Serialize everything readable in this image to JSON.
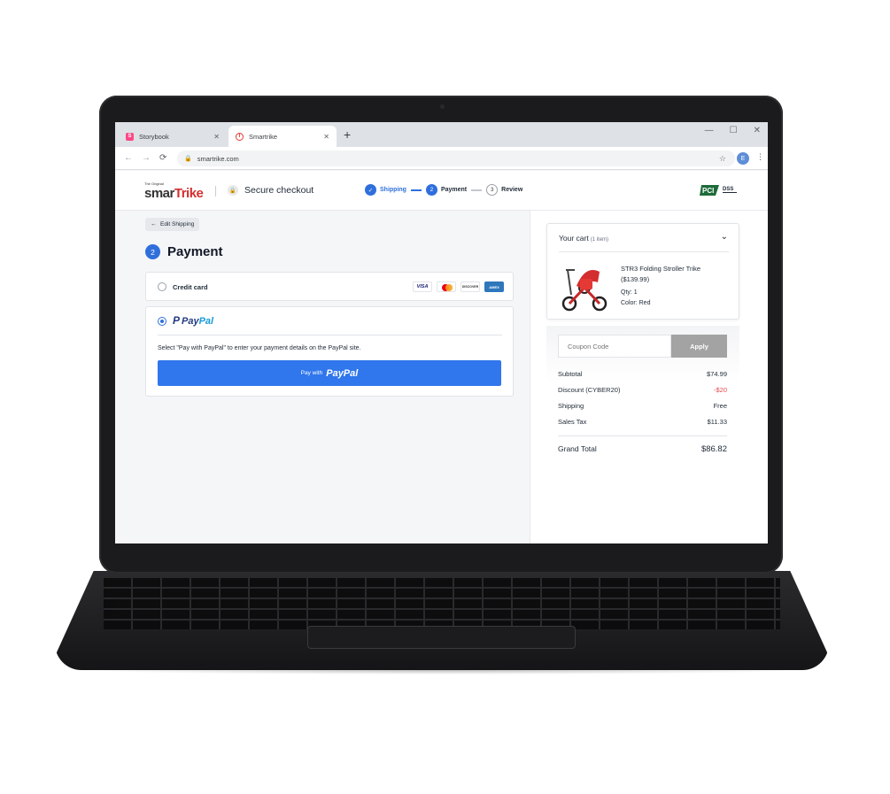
{
  "browser": {
    "tabs": [
      {
        "label": "Storybook",
        "favicon": "storybook-icon",
        "active": false
      },
      {
        "label": "Smartrike",
        "favicon": "smartrike-icon",
        "active": true
      }
    ],
    "url": "smartrike.com",
    "profile_initial": "E"
  },
  "header": {
    "logo_small": "The Original",
    "logo_main_a": "smar",
    "logo_main_b": "Trike",
    "secure_label": "Secure checkout",
    "steps": [
      {
        "num": "",
        "label": "Shipping",
        "state": "done"
      },
      {
        "num": "2",
        "label": "Payment",
        "state": "current"
      },
      {
        "num": "3",
        "label": "Review",
        "state": "todo"
      }
    ],
    "pci_label_a": "PCI",
    "pci_label_b": "DSS"
  },
  "payment": {
    "back_label": "Edit Shipping",
    "step_num": "2",
    "title": "Payment",
    "credit_card_label": "Credit card",
    "card_brands": [
      "VISA",
      "DISCOVER",
      "AMEX"
    ],
    "paypal_pay": "Pay",
    "paypal_pal": "Pal",
    "paypal_description": "Select \"Pay with PayPal\" to enter your payment details on the PayPal site.",
    "paypal_button_prefix": "Pay with",
    "paypal_button_brand": "PayPal",
    "selected_method": "paypal"
  },
  "cart": {
    "title": "Your cart",
    "count": "(1 item)",
    "item": {
      "name": "STR3 Folding Stroller Trike",
      "price": "($139.99)",
      "qty": "Qty: 1",
      "color": "Color: Red"
    }
  },
  "summary": {
    "coupon_placeholder": "Coupon Code",
    "apply_label": "Apply",
    "rows": [
      {
        "label": "Subtotal",
        "value": "$74.99"
      },
      {
        "label": "Discount (CYBER20)",
        "value": "-$20"
      },
      {
        "label": "Shipping",
        "value": "Free"
      },
      {
        "label": "Sales Tax",
        "value": "$11.33"
      }
    ],
    "total_label": "Grand Total",
    "total_value": "$86.82"
  },
  "colors": {
    "accent": "#2f6fdc",
    "paypal_button": "#3076ec",
    "discount": "#e5484d"
  }
}
